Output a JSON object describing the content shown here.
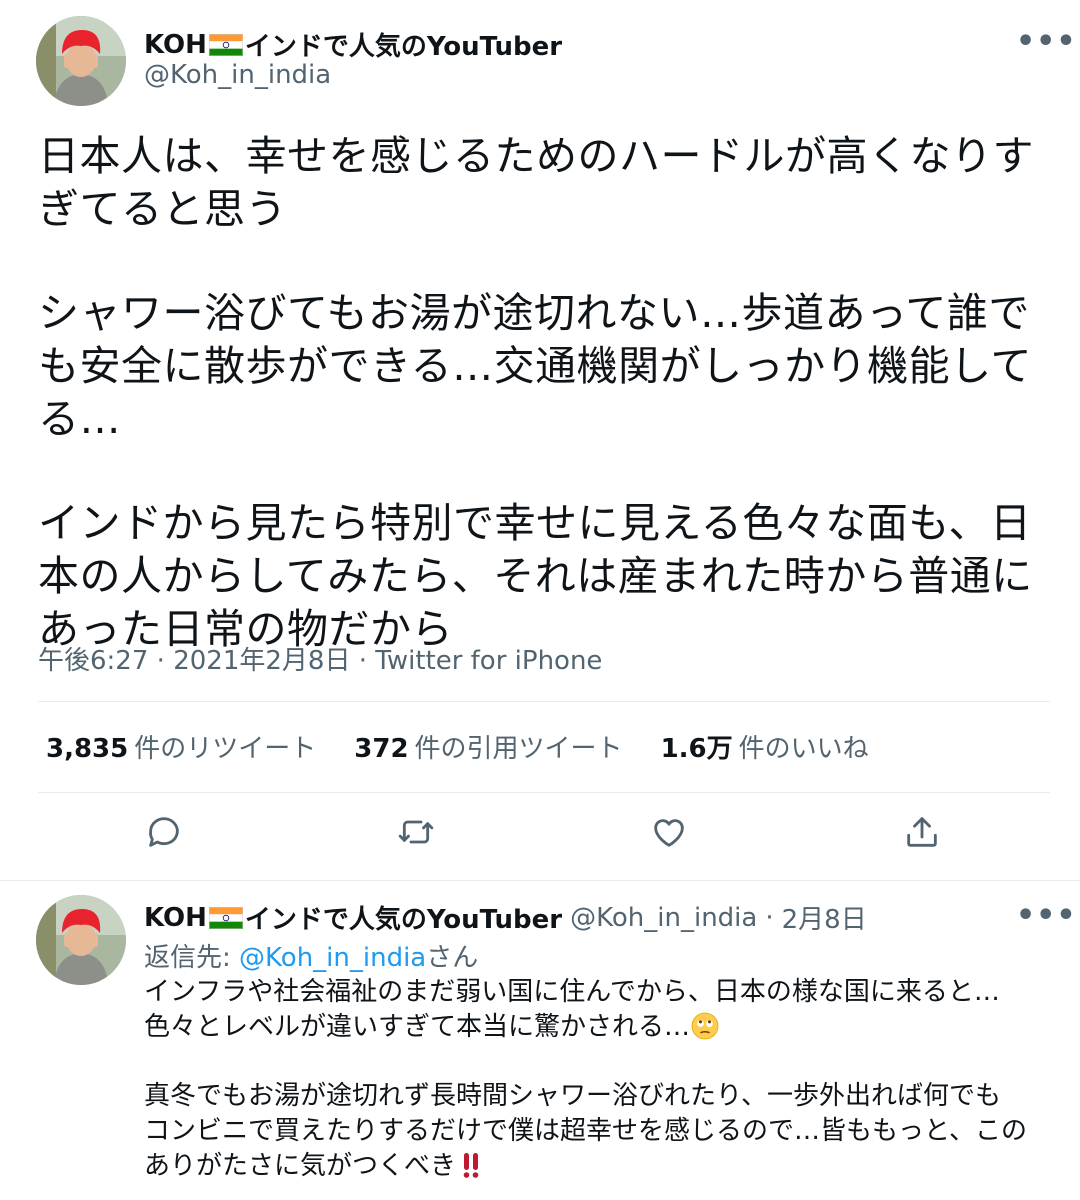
{
  "tweet": {
    "author": {
      "display_name": "KOH",
      "display_name_suffix": "インドで人気のYouTuber",
      "handle": "@Koh_in_india",
      "avatar": "user-avatar"
    },
    "more_icon": "•••",
    "paragraphs": [
      "日本人は、幸せを感じるためのハードルが高くなりすぎてると思う",
      "シャワー浴びてもお湯が途切れない…歩道あって誰でも安全に散歩ができる…交通機関がしっかり機能してる…",
      "インドから見たら特別で幸せに見える色々な面も、日本の人からしてみたら、それは産まれた時から普通にあった日常の物だから"
    ],
    "time": "午後6:27",
    "date": "2021年2月8日",
    "source": "Twitter for iPhone",
    "dot": "·",
    "stats": {
      "retweets_count": "3,835",
      "retweets_label": "件のリツイート",
      "quotes_count": "372",
      "quotes_label": "件の引用ツイート",
      "likes_count": "1.6万",
      "likes_label": "件のいいね"
    },
    "actions": [
      "reply-icon",
      "retweet-icon",
      "like-icon",
      "share-icon"
    ]
  },
  "reply": {
    "author": {
      "display_name": "KOH",
      "display_name_suffix": "インドで人気のYouTuber",
      "handle": "@Koh_in_india",
      "date": "2月8日"
    },
    "more_icon": "•••",
    "reply_to_prefix": "返信先: ",
    "reply_to_handle": "@Koh_in_india",
    "reply_to_suffix": "さん",
    "paragraph1_lines": [
      "インフラや社会福祉のまだ弱い国に住んでから、日本の様な国に来ると…",
      "色々とレベルが違いすぎて本当に驚かされる…"
    ],
    "paragraph2_lines": [
      "真冬でもお湯が途切れず長時間シャワー浴びれたり、一歩外出れば何でも",
      "コンビニで買えたりするだけで僕は超幸せを感じるので…皆ももっと、この",
      "ありがたさに気がつくべき"
    ],
    "emoji1": "face-with-rolling-eyes-emoji",
    "emoji2": "double-exclamation-emoji"
  },
  "colors": {
    "text": "#0f1419",
    "secondary": "#536471",
    "link": "#1d9bf0",
    "divider": "#e6ecf0"
  }
}
